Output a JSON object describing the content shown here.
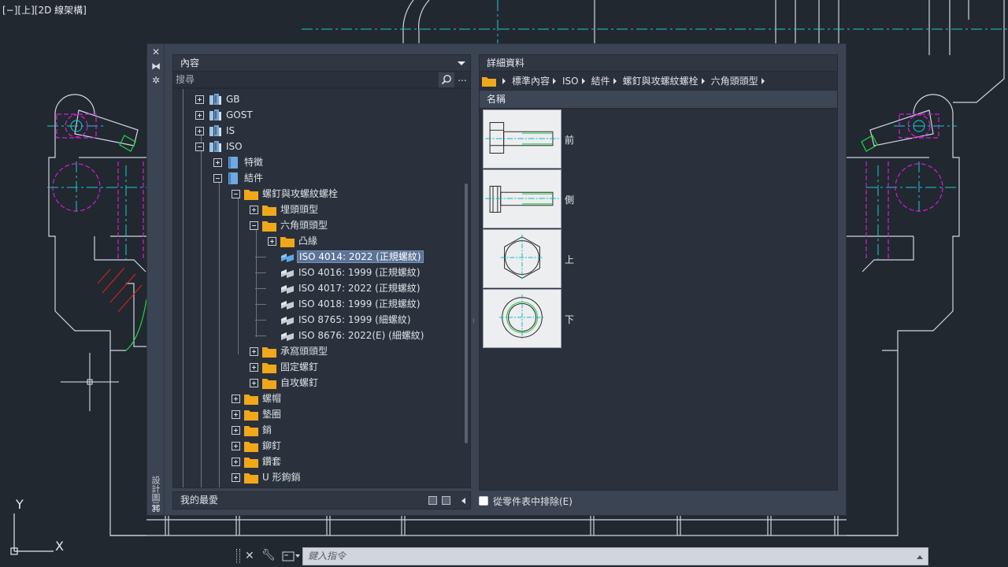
{
  "viewport": {
    "label": "[−][上][2D 線架構]"
  },
  "ucs": {
    "x_label": "X",
    "y_label": "Y"
  },
  "palette": {
    "strip_label": "設計圖元",
    "left": {
      "header": "內容",
      "search_placeholder": "搜尋",
      "more_label": "...",
      "favorites_label": "我的最愛",
      "tree": [
        {
          "label": "GB",
          "icon": "library-icon",
          "level": 0,
          "expander": "plus"
        },
        {
          "label": "GOST",
          "icon": "library-icon",
          "level": 0,
          "expander": "plus"
        },
        {
          "label": "IS",
          "icon": "library-icon",
          "level": 0,
          "expander": "plus"
        },
        {
          "label": "ISO",
          "icon": "library-icon",
          "level": 0,
          "expander": "minus"
        },
        {
          "label": "特徵",
          "icon": "book-icon",
          "level": 1,
          "expander": "plus"
        },
        {
          "label": "結件",
          "icon": "book-icon",
          "level": 1,
          "expander": "minus"
        },
        {
          "label": "螺釘與攻螺紋螺栓",
          "icon": "folder-icon",
          "level": 2,
          "expander": "minus"
        },
        {
          "label": "埋頭頭型",
          "icon": "folder-icon",
          "level": 3,
          "expander": "plus"
        },
        {
          "label": "六角頭頭型",
          "icon": "folder-icon",
          "level": 3,
          "expander": "minus"
        },
        {
          "label": "凸緣",
          "icon": "folder-icon",
          "level": 4,
          "expander": "plus"
        },
        {
          "label": "ISO 4014: 2022 (正規螺紋)",
          "icon": "bolt-blue-icon",
          "level": 4,
          "expander": "none",
          "selected": true
        },
        {
          "label": "ISO 4016: 1999  (正規螺紋)",
          "icon": "bolt-gray-icon",
          "level": 4,
          "expander": "none"
        },
        {
          "label": "ISO 4017: 2022 (正規螺紋)",
          "icon": "bolt-gray-icon",
          "level": 4,
          "expander": "none"
        },
        {
          "label": "ISO 4018: 1999  (正規螺紋)",
          "icon": "bolt-gray-icon",
          "level": 4,
          "expander": "none"
        },
        {
          "label": "ISO 8765: 1999 (細螺紋)",
          "icon": "bolt-gray-icon",
          "level": 4,
          "expander": "none"
        },
        {
          "label": "ISO 8676: 2022(E) (細螺紋)",
          "icon": "bolt-gray-icon",
          "level": 4,
          "expander": "none"
        },
        {
          "label": "承窩頭頭型",
          "icon": "folder-icon",
          "level": 3,
          "expander": "plus"
        },
        {
          "label": "固定螺釘",
          "icon": "folder-icon",
          "level": 3,
          "expander": "plus"
        },
        {
          "label": "自攻螺釘",
          "icon": "folder-icon",
          "level": 3,
          "expander": "plus"
        },
        {
          "label": "螺帽",
          "icon": "folder-icon",
          "level": 2,
          "expander": "plus"
        },
        {
          "label": "墊圈",
          "icon": "folder-icon",
          "level": 2,
          "expander": "plus"
        },
        {
          "label": "銷",
          "icon": "folder-icon",
          "level": 2,
          "expander": "plus"
        },
        {
          "label": "鉚釘",
          "icon": "folder-icon",
          "level": 2,
          "expander": "plus"
        },
        {
          "label": "鑽套",
          "icon": "folder-icon",
          "level": 2,
          "expander": "plus"
        },
        {
          "label": "U 形鉤銷",
          "icon": "folder-icon",
          "level": 2,
          "expander": "plus"
        }
      ]
    },
    "right": {
      "header": "詳細資料",
      "breadcrumb": [
        "標準內容",
        "ISO",
        "結件",
        "螺釘與攻螺紋螺栓",
        "六角頭頭型"
      ],
      "column_header": "名稱",
      "views": [
        {
          "label": "前",
          "view": "front"
        },
        {
          "label": "側",
          "view": "side"
        },
        {
          "label": "上",
          "view": "top"
        },
        {
          "label": "下",
          "view": "bottom"
        }
      ],
      "exclude_label": "從零件表中排除(E)",
      "exclude_checked": false
    }
  },
  "command_line": {
    "placeholder": "鍵入指令"
  },
  "colors": {
    "cad_background": "#212830",
    "cad_line": "#cfd6df",
    "cad_cyan": "#1ec8d8",
    "cad_magenta": "#d21ed2",
    "cad_green": "#22d64a",
    "cad_red": "#e02020",
    "folder": "#f0a81a",
    "selection": "#5b7398"
  }
}
